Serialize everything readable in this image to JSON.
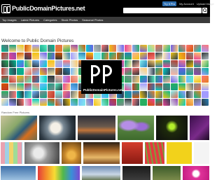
{
  "header": {
    "logo_text": "PublicDomainPictures.net",
    "links": [
      "Try it Pro",
      "My Account",
      "Upload Image"
    ],
    "search": {
      "value": "",
      "placeholder": ""
    }
  },
  "nav": {
    "items": [
      "Top Images",
      "Latest Pictures",
      "Categories",
      "Stock Photos",
      "Seasonal Photos"
    ]
  },
  "welcome_title": "Welcome to Public Domain Pictures",
  "featured_label": "Random Free Pictures",
  "colors": {
    "top_bar": "#000000",
    "nav_bar": "#3a3a3a",
    "pro_button": "#2f6fb0"
  },
  "center_logo_text": "PublicDomainPictures.net"
}
